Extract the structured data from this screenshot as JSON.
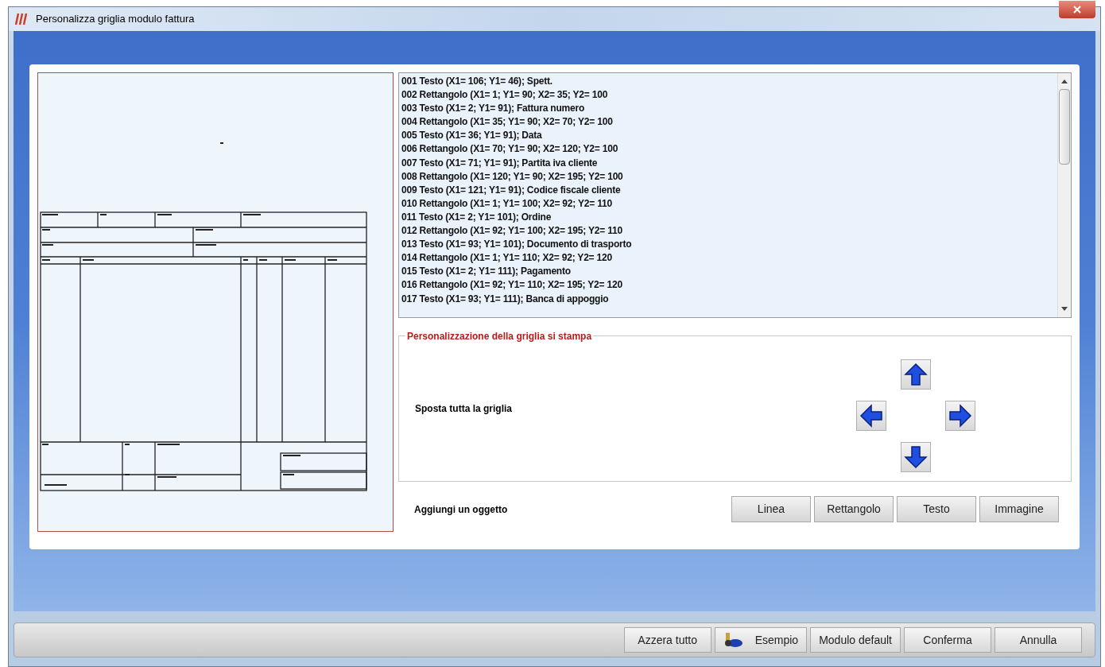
{
  "window": {
    "title": "Personalizza griglia modulo fattura"
  },
  "objects_list": {
    "items": [
      "001 Testo (X1= 106; Y1= 46); Spett.",
      "002 Rettangolo (X1= 1; Y1= 90; X2= 35; Y2= 100",
      "003 Testo (X1= 2; Y1= 91); Fattura numero",
      "004 Rettangolo (X1= 35; Y1= 90; X2= 70; Y2= 100",
      "005 Testo (X1= 36; Y1= 91); Data",
      "006 Rettangolo (X1= 70; Y1= 90; X2= 120; Y2= 100",
      "007 Testo (X1= 71; Y1= 91); Partita iva cliente",
      "008 Rettangolo (X1= 120; Y1= 90; X2= 195; Y2= 100",
      "009 Testo (X1= 121; Y1= 91); Codice fiscale cliente",
      "010 Rettangolo (X1= 1; Y1= 100; X2= 92; Y2= 110",
      "011 Testo (X1= 2; Y1= 101); Ordine",
      "012 Rettangolo (X1= 92; Y1= 100; X2= 195; Y2= 110",
      "013 Testo (X1= 93; Y1= 101); Documento di trasporto",
      "014 Rettangolo (X1= 1; Y1= 110; X2= 92; Y2= 120",
      "015 Testo (X1= 2; Y1= 111); Pagamento",
      "016 Rettangolo (X1= 92; Y1= 110; X2= 195; Y2= 120",
      "017 Testo (X1= 93; Y1= 111); Banca di appoggio"
    ]
  },
  "print_grid": {
    "title": "Personalizzazione della griglia si stampa",
    "move_label": "Sposta tutta la griglia",
    "add_label": "Aggiungi un oggetto",
    "add_buttons": [
      "Linea",
      "Rettangolo",
      "Testo",
      "Immagine"
    ]
  },
  "footer_buttons": [
    {
      "label": "Azzera tutto",
      "kind": "text"
    },
    {
      "label": "Esempio",
      "kind": "icon"
    },
    {
      "label": "Modulo default",
      "kind": "text"
    },
    {
      "label": "Conferma",
      "kind": "text"
    },
    {
      "label": "Annulla",
      "kind": "text"
    }
  ]
}
